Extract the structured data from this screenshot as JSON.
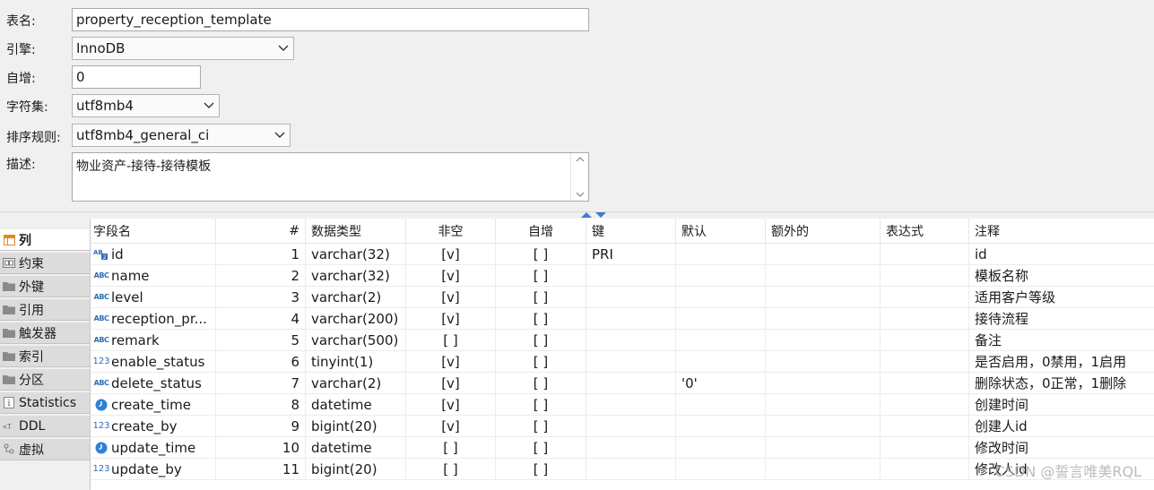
{
  "form": {
    "table_name_label": "表名:",
    "table_name": "property_reception_template",
    "engine_label": "引擎:",
    "engine": "InnoDB",
    "auto_increment_label": "自增:",
    "auto_increment": "0",
    "charset_label": "字符集:",
    "charset": "utf8mb4",
    "collation_label": "排序规则:",
    "collation": "utf8mb4_general_ci",
    "description_label": "描述:",
    "description": "物业资产-接待-接待模板"
  },
  "sidebar": {
    "tabs": [
      {
        "label": "列",
        "icon": "columns-icon"
      },
      {
        "label": "约束",
        "icon": "constraint-icon"
      },
      {
        "label": "外键",
        "icon": "folder-icon"
      },
      {
        "label": "引用",
        "icon": "folder-icon"
      },
      {
        "label": "触发器",
        "icon": "folder-icon"
      },
      {
        "label": "索引",
        "icon": "folder-icon"
      },
      {
        "label": "分区",
        "icon": "folder-icon"
      },
      {
        "label": "Statistics",
        "icon": "info-icon"
      },
      {
        "label": "DDL",
        "icon": "ddl-icon"
      },
      {
        "label": "虚拟",
        "icon": "virtual-icon"
      }
    ],
    "active_index": 0
  },
  "grid": {
    "headers": {
      "name": "字段名",
      "num": "#",
      "type": "数据类型",
      "not_null": "非空",
      "auto_inc": "自增",
      "key": "键",
      "default": "默认",
      "extra": "额外的",
      "expression": "表达式",
      "comment": "注释"
    },
    "rows": [
      {
        "icon": "key-abc",
        "name": "id",
        "num": "1",
        "type": "varchar(32)",
        "not_null": "[v]",
        "auto_inc": "[ ]",
        "key": "PRI",
        "default": "",
        "extra": "",
        "expression": "",
        "comment": "id"
      },
      {
        "icon": "abc",
        "name": "name",
        "num": "2",
        "type": "varchar(32)",
        "not_null": "[v]",
        "auto_inc": "[ ]",
        "key": "",
        "default": "",
        "extra": "",
        "expression": "",
        "comment": "模板名称"
      },
      {
        "icon": "abc",
        "name": "level",
        "num": "3",
        "type": "varchar(2)",
        "not_null": "[v]",
        "auto_inc": "[ ]",
        "key": "",
        "default": "",
        "extra": "",
        "expression": "",
        "comment": "适用客户等级"
      },
      {
        "icon": "abc",
        "name": "reception_pr...",
        "num": "4",
        "type": "varchar(200)",
        "not_null": "[v]",
        "auto_inc": "[ ]",
        "key": "",
        "default": "",
        "extra": "",
        "expression": "",
        "comment": "接待流程"
      },
      {
        "icon": "abc",
        "name": "remark",
        "num": "5",
        "type": "varchar(500)",
        "not_null": "[ ]",
        "auto_inc": "[ ]",
        "key": "",
        "default": "",
        "extra": "",
        "expression": "",
        "comment": "备注"
      },
      {
        "icon": "num",
        "name": "enable_status",
        "num": "6",
        "type": "tinyint(1)",
        "not_null": "[v]",
        "auto_inc": "[ ]",
        "key": "",
        "default": "",
        "extra": "",
        "expression": "",
        "comment": "是否启用，0禁用，1启用"
      },
      {
        "icon": "abc",
        "name": "delete_status",
        "num": "7",
        "type": "varchar(2)",
        "not_null": "[v]",
        "auto_inc": "[ ]",
        "key": "",
        "default": "'0'",
        "extra": "",
        "expression": "",
        "comment": "删除状态，0正常，1删除"
      },
      {
        "icon": "clock",
        "name": "create_time",
        "num": "8",
        "type": "datetime",
        "not_null": "[v]",
        "auto_inc": "[ ]",
        "key": "",
        "default": "",
        "extra": "",
        "expression": "",
        "comment": "创建时间"
      },
      {
        "icon": "num",
        "name": "create_by",
        "num": "9",
        "type": "bigint(20)",
        "not_null": "[v]",
        "auto_inc": "[ ]",
        "key": "",
        "default": "",
        "extra": "",
        "expression": "",
        "comment": "创建人id"
      },
      {
        "icon": "clock",
        "name": "update_time",
        "num": "10",
        "type": "datetime",
        "not_null": "[ ]",
        "auto_inc": "[ ]",
        "key": "",
        "default": "",
        "extra": "",
        "expression": "",
        "comment": "修改时间"
      },
      {
        "icon": "num",
        "name": "update_by",
        "num": "11",
        "type": "bigint(20)",
        "not_null": "[ ]",
        "auto_inc": "[ ]",
        "key": "",
        "default": "",
        "extra": "",
        "expression": "",
        "comment": "修改人id"
      }
    ]
  },
  "watermark": "CSDN @誓言唯美RQL",
  "colors": {
    "accent": "#2e6fb7",
    "splitter_arrow": "#3a7bd5",
    "folder": "#8a8a8a"
  }
}
